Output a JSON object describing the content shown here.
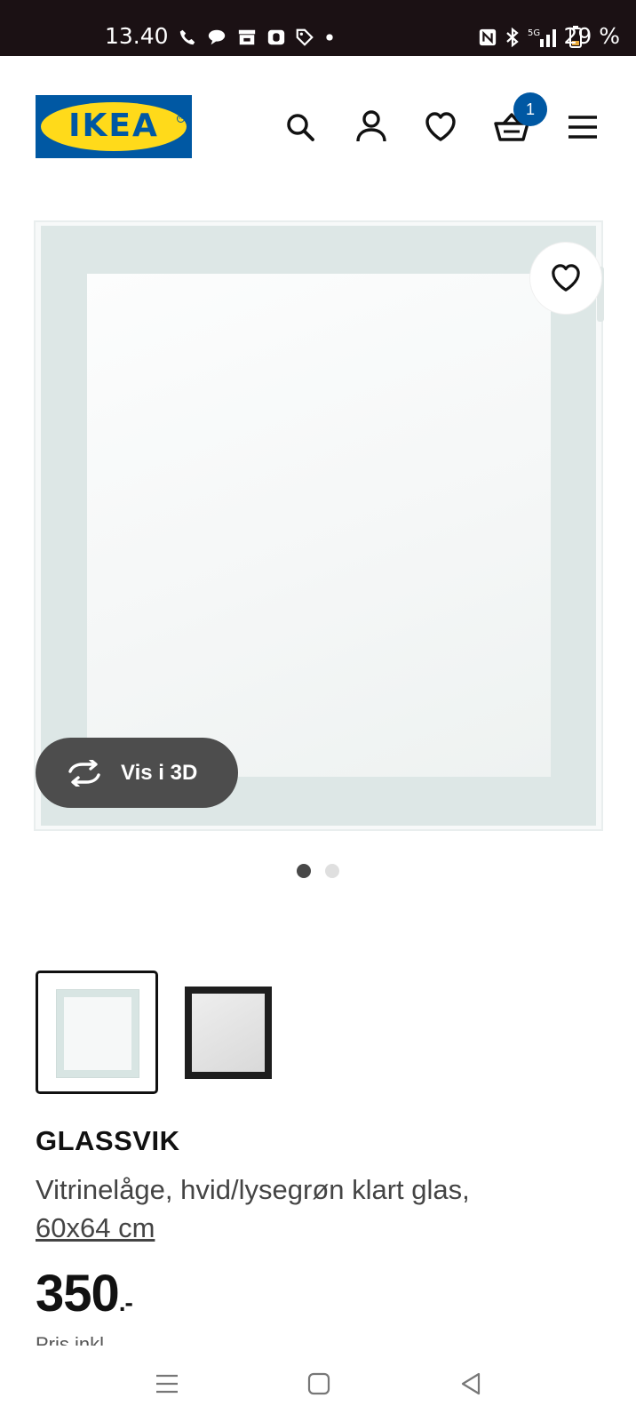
{
  "status_bar": {
    "time": "13.40",
    "battery": "29 %",
    "network": "5G",
    "icons_left": [
      "phone-icon",
      "chat-icon",
      "store-icon",
      "app-icon",
      "tag-icon",
      "dot-icon"
    ],
    "icons_right": [
      "nfc-icon",
      "bluetooth-icon",
      "signal-icon",
      "battery-icon"
    ]
  },
  "header": {
    "logo_text": "IKEA",
    "basket_count": "1",
    "icons": [
      "search-icon",
      "user-icon",
      "heart-icon",
      "basket-icon",
      "menu-icon"
    ],
    "colors": {
      "brand_blue": "#0058a3",
      "brand_yellow": "#ffda1a"
    }
  },
  "gallery": {
    "view3d_label": "Vis i 3D",
    "active_slide": 1,
    "slide_count": 2
  },
  "variants": [
    {
      "name": "hvid/lysegrøn klart glas",
      "selected": true
    },
    {
      "name": "sort",
      "selected": false
    }
  ],
  "product": {
    "name": "GLASSVIK",
    "description": "Vitrinelåge, hvid/lysegrøn klart glas,",
    "size": "60x64 cm",
    "price": "350",
    "price_suffix": ".-",
    "partial_text": "Pris inkl..."
  },
  "nav_bar": {
    "icons": [
      "recent-apps-icon",
      "home-icon",
      "back-icon"
    ]
  }
}
